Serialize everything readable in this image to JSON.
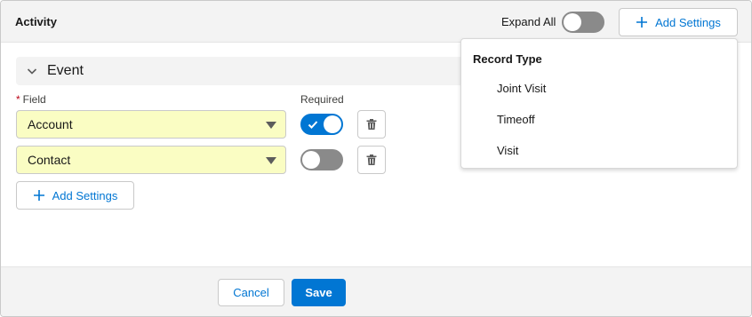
{
  "header": {
    "title": "Activity",
    "expand_all_label": "Expand All",
    "expand_all_on": false,
    "add_settings_label": "Add Settings"
  },
  "section": {
    "label": "Event",
    "field_label": "Field",
    "required_marker": "*",
    "required_label": "Required",
    "rows": [
      {
        "field": "Account",
        "required": true
      },
      {
        "field": "Contact",
        "required": false
      }
    ],
    "add_settings_label": "Add Settings"
  },
  "dropdown": {
    "heading": "Record Type",
    "items": [
      "Joint Visit",
      "Timeoff",
      "Visit"
    ]
  },
  "footer": {
    "cancel_label": "Cancel",
    "save_label": "Save"
  },
  "colors": {
    "brand": "#0176d3",
    "field_highlight": "#fafdc3",
    "required_marker": "#ba0517"
  }
}
